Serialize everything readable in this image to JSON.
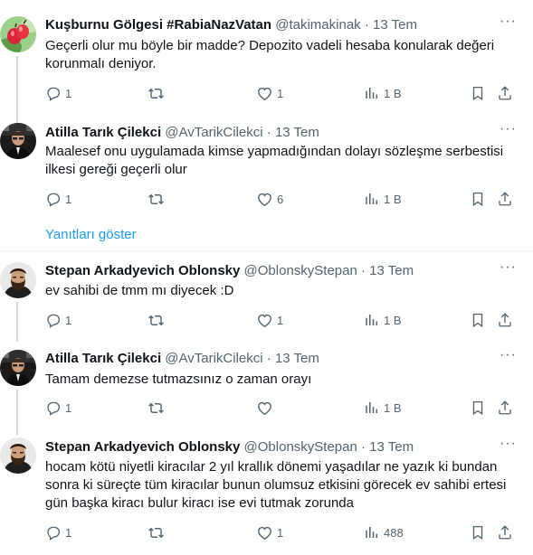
{
  "tweets": [
    {
      "name": "Kuşburnu Gölgesi #RabiaNazVatan",
      "handle": "@takimakinak",
      "dot": "·",
      "time": "13 Tem",
      "text": "Geçerli olur mu böyle bir madde? Depozito vadeli hesaba konularak değeri korunmalı deniyor.",
      "replies": "1",
      "retweets": "",
      "likes": "1",
      "views": "1 B",
      "avatar_icon": "rosehip-avatar"
    },
    {
      "name": "Atilla Tarık Çilekci",
      "handle": "@AvTarikCilekci",
      "dot": "·",
      "time": "13 Tem",
      "text": "Maalesef onu uygulamada kimse yapmadığından dolayı sözleşme serbestisi ilkesi gereği geçerli olur",
      "replies": "1",
      "retweets": "",
      "likes": "6",
      "views": "1 B",
      "avatar_icon": "lawyer-office-avatar"
    },
    {
      "name": "Stepan Arkadyevich Oblonsky",
      "handle": "@OblonskyStepan",
      "dot": "·",
      "time": "13 Tem",
      "text": "ev sahibi de tmm mı diyecek :D",
      "replies": "1",
      "retweets": "",
      "likes": "1",
      "views": "1 B",
      "avatar_icon": "bearded-man-avatar"
    },
    {
      "name": "Atilla Tarık Çilekci",
      "handle": "@AvTarikCilekci",
      "dot": "·",
      "time": "13 Tem",
      "text": "Tamam demezse tutmazsınız o zaman orayı",
      "replies": "1",
      "retweets": "",
      "likes": "",
      "views": "1 B",
      "avatar_icon": "lawyer-office-avatar"
    },
    {
      "name": "Stepan Arkadyevich Oblonsky",
      "handle": "@OblonskyStepan",
      "dot": "·",
      "time": "13 Tem",
      "text": "hocam kötü niyetli kiracılar 2 yıl krallık dönemi yaşadılar ne yazık ki bundan sonra ki süreçte tüm kiracılar bunun olumsuz etkisini görecek ev sahibi ertesi gün başka kiracı bulur kiracı ise evi tutmak zorunda",
      "replies": "1",
      "retweets": "",
      "likes": "1",
      "views": "488",
      "avatar_icon": "bearded-man-avatar"
    }
  ],
  "show_replies": "Yanıtları göster",
  "more_icon": "ellipsis-icon",
  "colors": {
    "text": "#0f1419",
    "secondary": "#536471",
    "link": "#1d9bf0",
    "divider": "#eff3f4",
    "thread_line": "#cfd9de"
  }
}
